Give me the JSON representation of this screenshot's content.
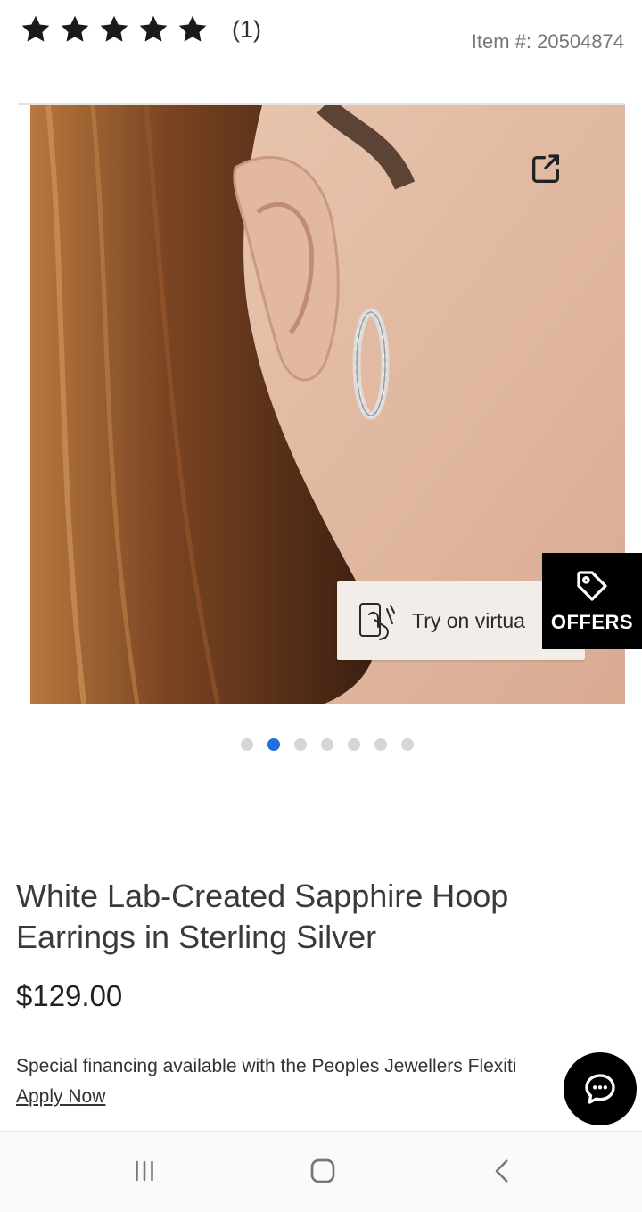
{
  "rating": {
    "stars": 5,
    "review_count": "(1)"
  },
  "item_number": "Item #: 20504874",
  "gallery": {
    "total_images": 7,
    "active_index": 1
  },
  "try_on": {
    "label": "Try on virtua"
  },
  "offers": {
    "label": "OFFERS"
  },
  "product": {
    "title": "White Lab-Created Sapphire Hoop Earrings in Sterling Silver",
    "price": "$129.00"
  },
  "financing": {
    "text": "Special financing available with the Peoples Jewellers Flexiti",
    "link": "Apply Now"
  },
  "icons": {
    "star": "star-icon",
    "share": "share-icon",
    "try_on": "hand-phone-icon",
    "offers": "tag-icon",
    "chat": "chat-bubble-icon",
    "nav_recent": "recent-apps-icon",
    "nav_home": "home-icon",
    "nav_back": "back-icon"
  },
  "colors": {
    "active_dot": "#1f6fe0",
    "inactive_dot": "#d6d6d6",
    "offers_bg": "#000000",
    "try_on_bg": "#f1ede9"
  }
}
